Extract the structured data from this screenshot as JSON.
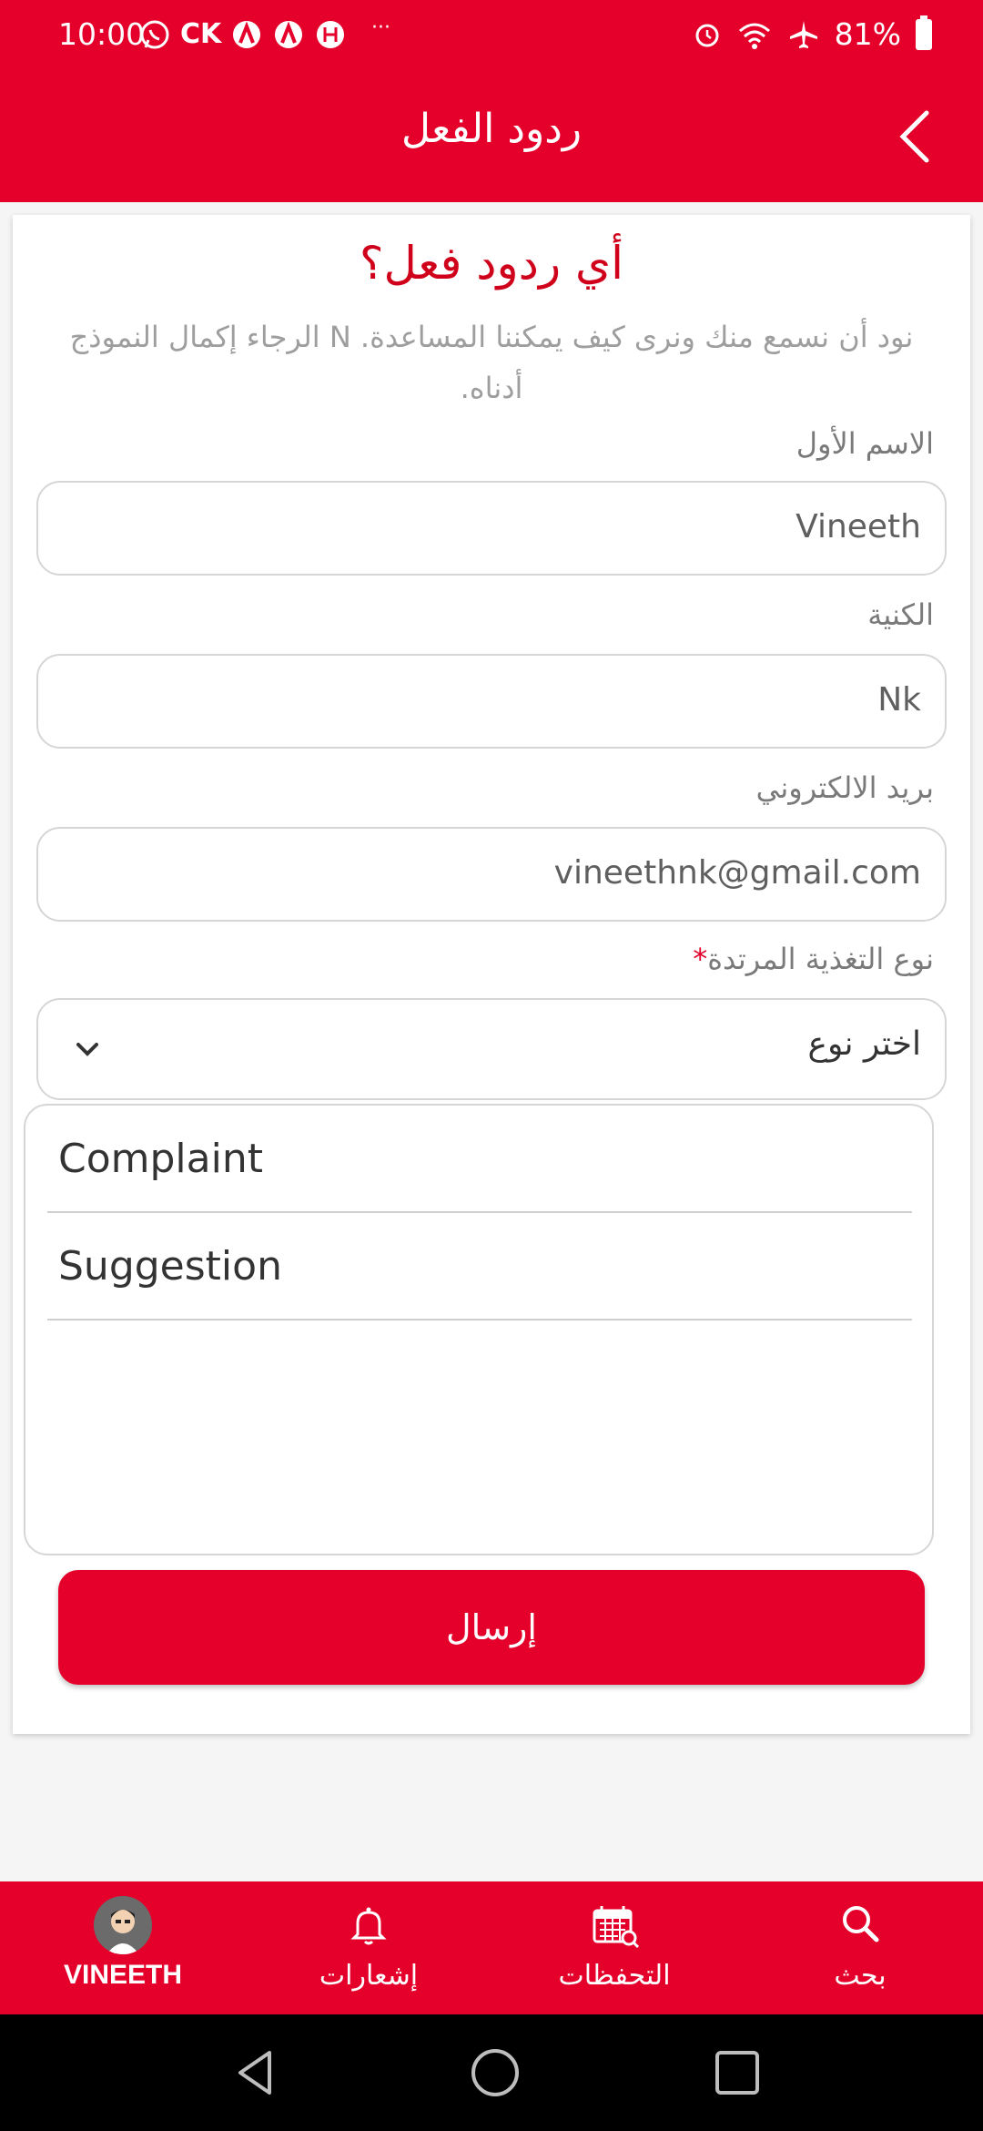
{
  "status_bar": {
    "time": "10:00",
    "left_icons": [
      "whatsapp-icon",
      "ck-icon",
      "app-a-icon",
      "app-a2-icon",
      "hotstar-icon"
    ],
    "ck_text": "CK",
    "dots": "···",
    "battery": "81%",
    "right_icons": [
      "alarm-icon",
      "wifi-icon",
      "airplane-icon",
      "battery-icon"
    ]
  },
  "app_bar": {
    "title": "ردود الفعل",
    "back_icon": "chevron-right-icon"
  },
  "form": {
    "heading": "أي ردود فعل؟",
    "subtitle": "نود أن نسمع منك ونرى كيف يمكننا المساعدة. N الرجاء إكمال النموذج أدناه.",
    "first_name_label": "الاسم الأول",
    "first_name_value": "Vineeth",
    "last_name_label": "الكنية",
    "last_name_value": "Nk",
    "email_label": "بريد الالكتروني",
    "email_value": "vineethnk@gmail.com",
    "feedback_type_label": "نوع التغذية المرتدة",
    "required_mark": "*",
    "feedback_type_placeholder": "اختر نوع",
    "options": [
      "Complaint",
      "Suggestion"
    ],
    "submit_label": "إرسال"
  },
  "bottom_nav": {
    "items": [
      {
        "label": "VINEETH",
        "icon": "avatar-icon"
      },
      {
        "label": "إشعارات",
        "icon": "bell-icon"
      },
      {
        "label": "التحفظات",
        "icon": "calendar-search-icon"
      },
      {
        "label": "بحث",
        "icon": "search-icon"
      }
    ]
  },
  "colors": {
    "primary": "#e4002b",
    "heading": "#d0021b",
    "muted": "#9e9e9e"
  }
}
